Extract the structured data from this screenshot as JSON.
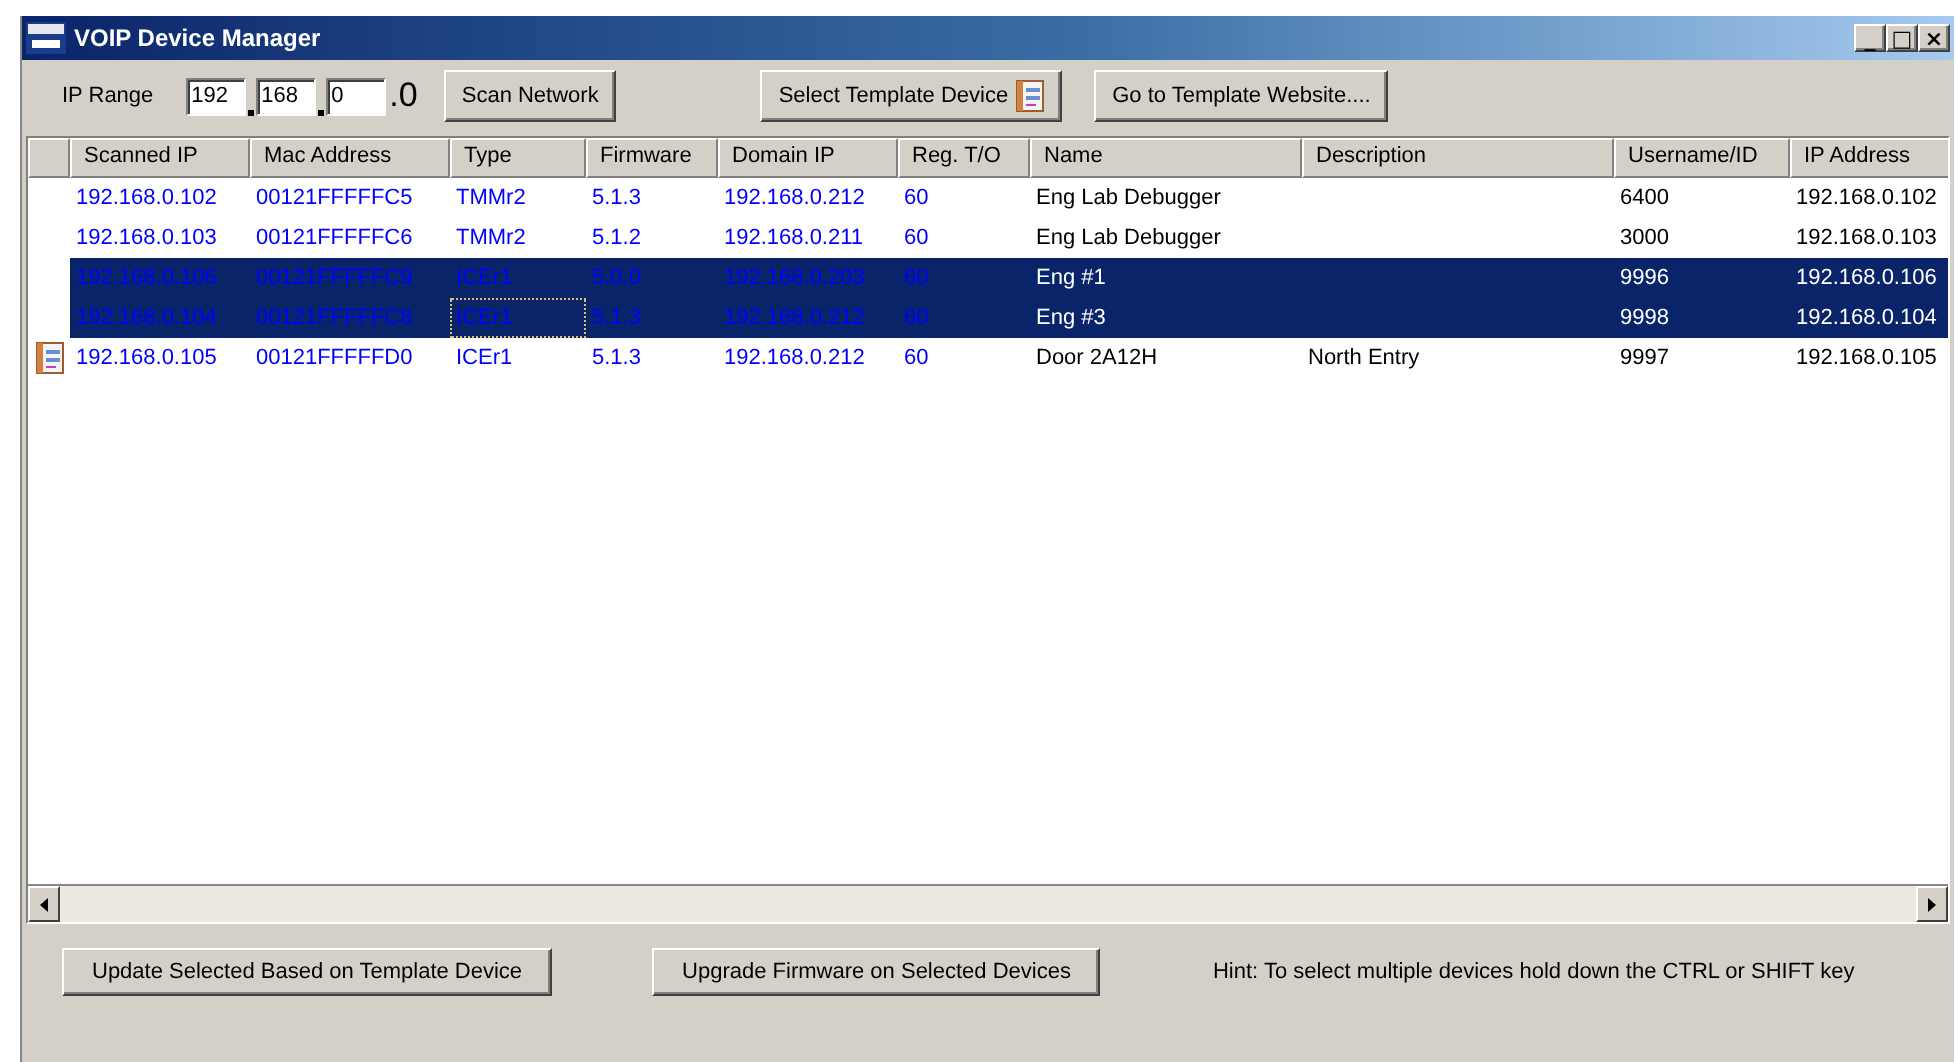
{
  "window": {
    "title": "VOIP Device Manager",
    "controls": [
      "_",
      "□",
      "×"
    ]
  },
  "toolbar": {
    "ip_range_label": "IP Range",
    "ip_octets": [
      "192",
      "168",
      "0"
    ],
    "ip_last": ".0",
    "scan_button": "Scan Network",
    "template_button": "Select Template Device",
    "website_button": "Go to Template Website...."
  },
  "table": {
    "columns": [
      {
        "label": "Scanned IP",
        "kind": "scanned"
      },
      {
        "label": "Mac Address",
        "kind": "scanned"
      },
      {
        "label": "Type",
        "kind": "scanned"
      },
      {
        "label": "Firmware",
        "kind": "scanned"
      },
      {
        "label": "Domain IP",
        "kind": "scanned"
      },
      {
        "label": "Reg. T/O",
        "kind": "scanned"
      },
      {
        "label": "Name",
        "kind": "config"
      },
      {
        "label": "Description",
        "kind": "config"
      },
      {
        "label": "Username/ID",
        "kind": "config"
      },
      {
        "label": "IP Address",
        "kind": "config"
      }
    ],
    "rows": [
      {
        "selected": false,
        "template": false,
        "focused": false,
        "cells": [
          "192.168.0.102",
          "00121FFFFFC5",
          "TMMr2",
          "5.1.3",
          "192.168.0.212",
          "60",
          "Eng Lab Debugger",
          "",
          "6400",
          "192.168.0.102"
        ]
      },
      {
        "selected": false,
        "template": false,
        "focused": false,
        "cells": [
          "192.168.0.103",
          "00121FFFFFC6",
          "TMMr2",
          "5.1.2",
          "192.168.0.211",
          "60",
          "Eng Lab Debugger",
          "",
          "3000",
          "192.168.0.103"
        ]
      },
      {
        "selected": true,
        "template": false,
        "focused": false,
        "cells": [
          "192.168.0.106",
          "00121FFFFFC9",
          "ICEr1",
          "5.0.0",
          "192.168.0.203",
          "60",
          "Eng #1",
          "",
          "9996",
          "192.168.0.106"
        ]
      },
      {
        "selected": true,
        "template": false,
        "focused": true,
        "cells": [
          "192.168.0.104",
          "00121FFFFFC8",
          "ICEr1",
          "5.1.3",
          "192.168.0.212",
          "60",
          "Eng #3",
          "",
          "9998",
          "192.168.0.104"
        ]
      },
      {
        "selected": false,
        "template": true,
        "focused": false,
        "cells": [
          "192.168.0.105",
          "00121FFFFFD0",
          "ICEr1",
          "5.1.3",
          "192.168.0.212",
          "60",
          "Door 2A12H",
          "North Entry",
          "9997",
          "192.168.0.105"
        ]
      }
    ]
  },
  "footer": {
    "update_button": "Update Selected Based on Template Device",
    "upgrade_button": "Upgrade Firmware on Selected Devices",
    "hint": "Hint: To select multiple devices hold down the CTRL or SHIFT key"
  }
}
